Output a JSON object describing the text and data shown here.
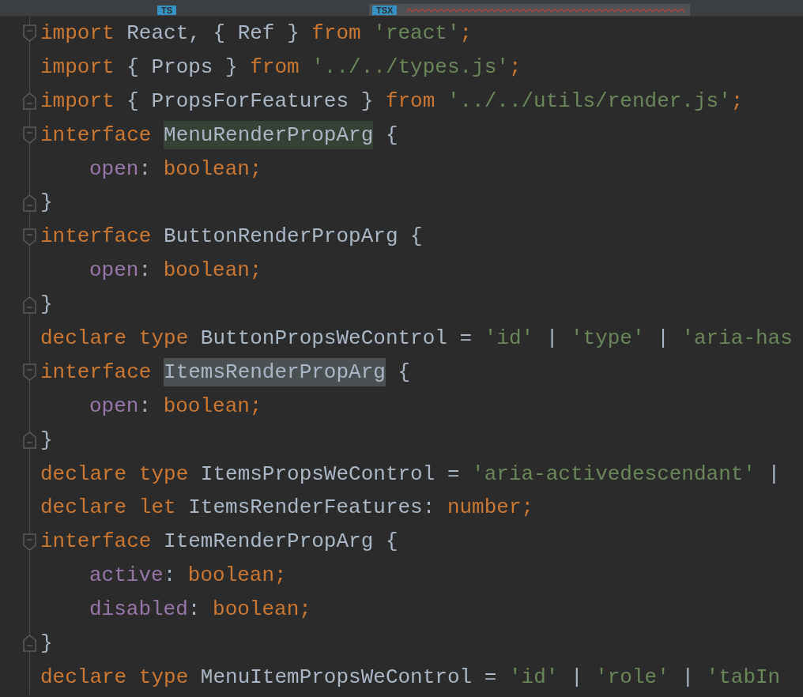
{
  "tabs": [
    {
      "badge": "TS",
      "selected": false,
      "error": false
    },
    {
      "badge": "TSX",
      "selected": true,
      "error": true
    }
  ],
  "lines": [
    {
      "fold_start": true,
      "tokens": [
        {
          "kind": "keyword",
          "text": "import "
        },
        {
          "kind": "plain",
          "text": "React, { Ref } "
        },
        {
          "kind": "keyword",
          "text": "from "
        },
        {
          "kind": "string",
          "text": "'react'"
        },
        {
          "kind": "keyword",
          "text": ";"
        }
      ]
    },
    {
      "tokens": [
        {
          "kind": "keyword",
          "text": "import "
        },
        {
          "kind": "plain",
          "text": "{ Props } "
        },
        {
          "kind": "keyword",
          "text": "from "
        },
        {
          "kind": "string",
          "text": "'../../types.js'"
        },
        {
          "kind": "keyword",
          "text": ";"
        }
      ]
    },
    {
      "fold_end": true,
      "tokens": [
        {
          "kind": "keyword",
          "text": "import "
        },
        {
          "kind": "plain",
          "text": "{ PropsForFeatures } "
        },
        {
          "kind": "keyword",
          "text": "from "
        },
        {
          "kind": "string",
          "text": "'../../utils/render.js'"
        },
        {
          "kind": "keyword",
          "text": ";"
        }
      ]
    },
    {
      "fold_start": true,
      "tokens": [
        {
          "kind": "keyword",
          "text": "interface "
        },
        {
          "kind": "write-highlight",
          "text": "MenuRenderPropArg"
        },
        {
          "kind": "plain",
          "text": " {"
        }
      ]
    },
    {
      "indented": true,
      "tokens": [
        {
          "kind": "property",
          "text": "open"
        },
        {
          "kind": "plain",
          "text": ": "
        },
        {
          "kind": "keyword",
          "text": "boolean;"
        }
      ]
    },
    {
      "fold_end": true,
      "tokens": [
        {
          "kind": "plain",
          "text": "}"
        }
      ]
    },
    {
      "fold_start": true,
      "tokens": [
        {
          "kind": "keyword",
          "text": "interface "
        },
        {
          "kind": "plain",
          "text": "ButtonRenderPropArg {"
        }
      ]
    },
    {
      "indented": true,
      "tokens": [
        {
          "kind": "property",
          "text": "open"
        },
        {
          "kind": "plain",
          "text": ": "
        },
        {
          "kind": "keyword",
          "text": "boolean;"
        }
      ]
    },
    {
      "fold_end": true,
      "tokens": [
        {
          "kind": "plain",
          "text": "}"
        }
      ]
    },
    {
      "tokens": [
        {
          "kind": "keyword",
          "text": "declare type "
        },
        {
          "kind": "plain",
          "text": "ButtonPropsWeControl = "
        },
        {
          "kind": "string",
          "text": "'id'"
        },
        {
          "kind": "plain",
          "text": " | "
        },
        {
          "kind": "string",
          "text": "'type'"
        },
        {
          "kind": "plain",
          "text": " | "
        },
        {
          "kind": "string",
          "text": "'aria-has"
        }
      ]
    },
    {
      "fold_start": true,
      "tokens": [
        {
          "kind": "keyword",
          "text": "interface "
        },
        {
          "kind": "read-highlight",
          "text": "ItemsRenderPropArg"
        },
        {
          "kind": "plain",
          "text": " {"
        }
      ]
    },
    {
      "indented": true,
      "tokens": [
        {
          "kind": "property",
          "text": "open"
        },
        {
          "kind": "plain",
          "text": ": "
        },
        {
          "kind": "keyword",
          "text": "boolean;"
        }
      ]
    },
    {
      "fold_end": true,
      "tokens": [
        {
          "kind": "plain",
          "text": "}"
        }
      ]
    },
    {
      "tokens": [
        {
          "kind": "keyword",
          "text": "declare type "
        },
        {
          "kind": "plain",
          "text": "ItemsPropsWeControl = "
        },
        {
          "kind": "string",
          "text": "'aria-activedescendant'"
        },
        {
          "kind": "plain",
          "text": " |"
        }
      ]
    },
    {
      "tokens": [
        {
          "kind": "keyword",
          "text": "declare let "
        },
        {
          "kind": "plain",
          "text": "ItemsRenderFeatures: "
        },
        {
          "kind": "keyword",
          "text": "number;"
        }
      ]
    },
    {
      "fold_start": true,
      "tokens": [
        {
          "kind": "keyword",
          "text": "interface "
        },
        {
          "kind": "plain",
          "text": "ItemRenderPropArg {"
        }
      ]
    },
    {
      "indented": true,
      "tokens": [
        {
          "kind": "property",
          "text": "active"
        },
        {
          "kind": "plain",
          "text": ": "
        },
        {
          "kind": "keyword",
          "text": "boolean;"
        }
      ]
    },
    {
      "indented": true,
      "tokens": [
        {
          "kind": "property",
          "text": "disabled"
        },
        {
          "kind": "plain",
          "text": ": "
        },
        {
          "kind": "keyword",
          "text": "boolean;"
        }
      ]
    },
    {
      "fold_end": true,
      "tokens": [
        {
          "kind": "plain",
          "text": "}"
        }
      ]
    },
    {
      "tokens": [
        {
          "kind": "keyword",
          "text": "declare type "
        },
        {
          "kind": "plain",
          "text": "MenuItemPropsWeControl = "
        },
        {
          "kind": "string",
          "text": "'id'"
        },
        {
          "kind": "plain",
          "text": " | "
        },
        {
          "kind": "string",
          "text": "'role'"
        },
        {
          "kind": "plain",
          "text": " | "
        },
        {
          "kind": "string",
          "text": "'tabIn"
        }
      ]
    }
  ]
}
